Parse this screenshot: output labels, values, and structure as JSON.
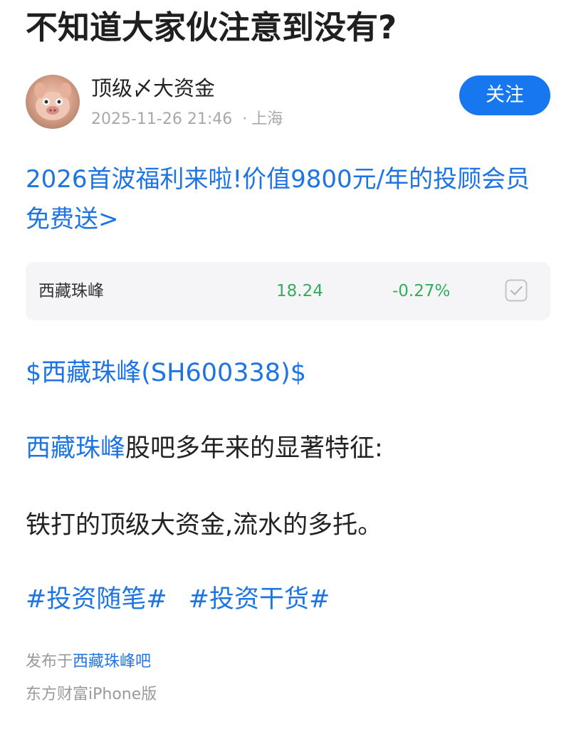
{
  "post": {
    "title": "不知道大家伙注意到没有?",
    "author": {
      "name": "顶级〆大资金",
      "date": "2025-11-26 21:46",
      "separator": "·",
      "location": "上海",
      "avatar_icon": "pig-avatar-icon"
    },
    "follow_label": "关注",
    "promo_text": "2026首波福利来啦!价值9800元/年的投顾会员免费送>",
    "stock_card": {
      "name": "西藏珠峰",
      "price": "18.24",
      "change": "-0.27%",
      "change_color": "#2fae5b",
      "checkbox_icon": "checkbox-icon"
    },
    "stock_tag": "$西藏珠峰(SH600338)$",
    "paragraph1_link": "西藏珠峰",
    "paragraph1_rest": "股吧多年来的显著特征:",
    "paragraph2": "铁打的顶级大资金,流水的多托。",
    "topics": [
      "#投资随笔#",
      "#投资干货#"
    ],
    "published_prefix": "发布于",
    "published_bar": "西藏珠峰吧",
    "client": "东方财富iPhone版"
  },
  "colors": {
    "accent": "#1677ee",
    "link": "#1d74e3",
    "muted": "#a8a8a8"
  }
}
